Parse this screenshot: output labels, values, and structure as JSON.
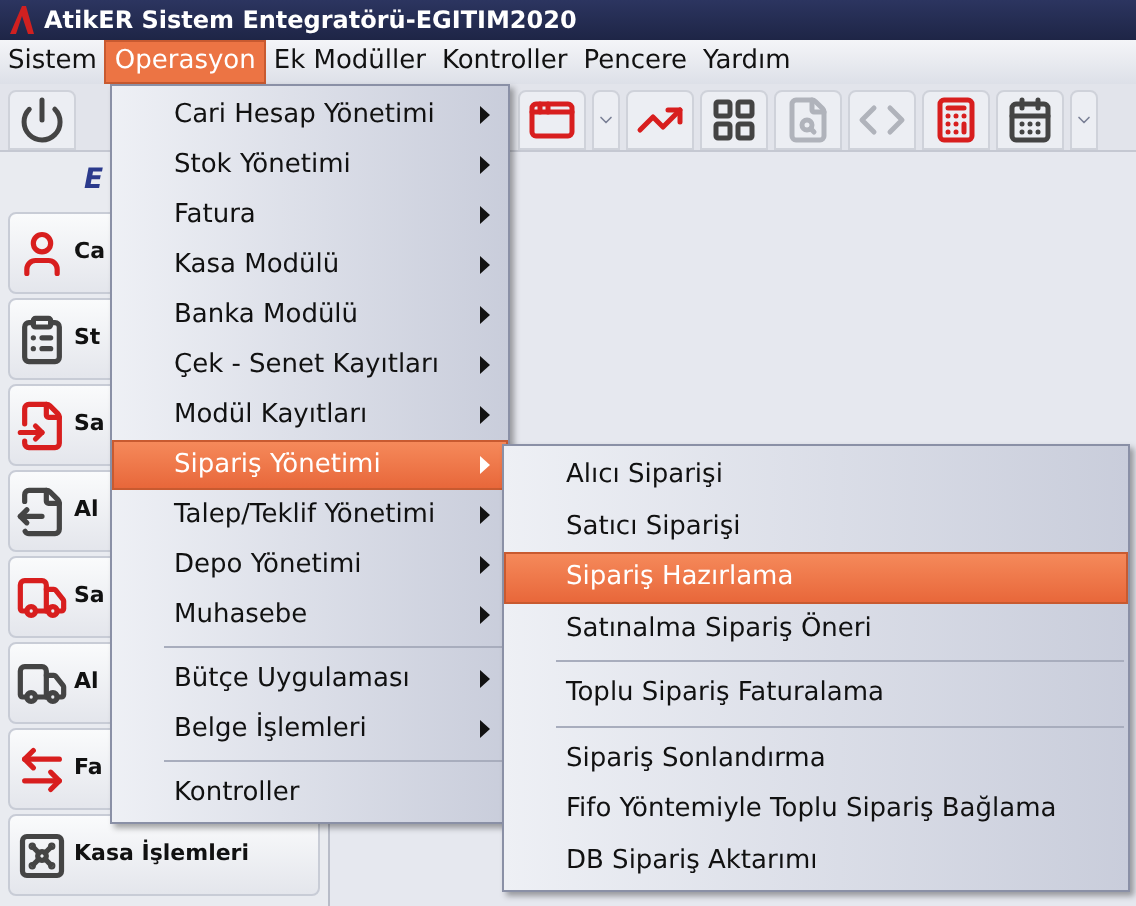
{
  "window": {
    "title": "AtikER Sistem Entegratörü-EGITIM2020"
  },
  "menubar": [
    {
      "label": "Sistem",
      "selected": false
    },
    {
      "label": "Operasyon",
      "selected": true
    },
    {
      "label": "Ek Modüller",
      "selected": false
    },
    {
      "label": "Kontroller",
      "selected": false
    },
    {
      "label": "Pencere",
      "selected": false
    },
    {
      "label": "Yardım",
      "selected": false
    }
  ],
  "toolbar": [
    {
      "kind": "power",
      "disabled": false
    },
    {
      "kind": "window",
      "disabled": false
    },
    {
      "kind": "dropdown",
      "disabled": false
    },
    {
      "kind": "chart",
      "disabled": false
    },
    {
      "kind": "tiles",
      "disabled": false
    },
    {
      "kind": "search",
      "disabled": true
    },
    {
      "kind": "code",
      "disabled": true
    },
    {
      "kind": "calculator",
      "disabled": false
    },
    {
      "kind": "calendar",
      "disabled": false
    },
    {
      "kind": "dropdown",
      "disabled": false
    }
  ],
  "sidebar": {
    "header": "E",
    "items": [
      {
        "kind": "user",
        "label": "Ca"
      },
      {
        "kind": "clipboard",
        "label": "St"
      },
      {
        "kind": "doc-in",
        "label": "Sa"
      },
      {
        "kind": "doc-out",
        "label": "Al"
      },
      {
        "kind": "truck-in",
        "label": "Sa"
      },
      {
        "kind": "truck-out",
        "label": "Al"
      },
      {
        "kind": "doc-swap",
        "label": "Fa"
      },
      {
        "kind": "safe",
        "label": "Kasa İşlemleri"
      }
    ]
  },
  "menu": {
    "items": [
      {
        "kind": "item",
        "label": "Cari Hesap Yönetimi",
        "submenu": true,
        "selected": false
      },
      {
        "kind": "item",
        "label": "Stok Yönetimi",
        "submenu": true,
        "selected": false
      },
      {
        "kind": "item",
        "label": "Fatura",
        "submenu": true,
        "selected": false
      },
      {
        "kind": "item",
        "label": "Kasa Modülü",
        "submenu": true,
        "selected": false
      },
      {
        "kind": "item",
        "label": "Banka Modülü",
        "submenu": true,
        "selected": false
      },
      {
        "kind": "item",
        "label": "Çek - Senet Kayıtları",
        "submenu": true,
        "selected": false
      },
      {
        "kind": "item",
        "label": "Modül Kayıtları",
        "submenu": true,
        "selected": false
      },
      {
        "kind": "item",
        "label": "Sipariş Yönetimi",
        "submenu": true,
        "selected": true
      },
      {
        "kind": "item",
        "label": "Talep/Teklif Yönetimi",
        "submenu": true,
        "selected": false
      },
      {
        "kind": "item",
        "label": "Depo Yönetimi",
        "submenu": true,
        "selected": false
      },
      {
        "kind": "item",
        "label": "Muhasebe",
        "submenu": true,
        "selected": false
      },
      {
        "kind": "separator"
      },
      {
        "kind": "item",
        "label": "Bütçe Uygulaması",
        "submenu": true,
        "selected": false
      },
      {
        "kind": "item",
        "label": "Belge İşlemleri",
        "submenu": true,
        "selected": false
      },
      {
        "kind": "separator"
      },
      {
        "kind": "item",
        "label": "Kontroller",
        "submenu": false,
        "selected": false
      }
    ]
  },
  "submenu": {
    "items": [
      {
        "kind": "item",
        "label": "Alıcı Siparişi",
        "selected": false
      },
      {
        "kind": "item",
        "label": "Satıcı Siparişi",
        "selected": false
      },
      {
        "kind": "item",
        "label": "Sipariş Hazırlama",
        "selected": true
      },
      {
        "kind": "item",
        "label": "Satınalma Sipariş Öneri",
        "selected": false
      },
      {
        "kind": "separator"
      },
      {
        "kind": "item",
        "label": "Toplu Sipariş Faturalama",
        "selected": false
      },
      {
        "kind": "separator"
      },
      {
        "kind": "item",
        "label": "Sipariş Sonlandırma",
        "selected": false
      },
      {
        "kind": "item",
        "label": "Fifo Yöntemiyle Toplu Sipariş Bağlama",
        "selected": false
      },
      {
        "kind": "item",
        "label": "DB Sipariş Aktarımı",
        "selected": false
      }
    ]
  }
}
